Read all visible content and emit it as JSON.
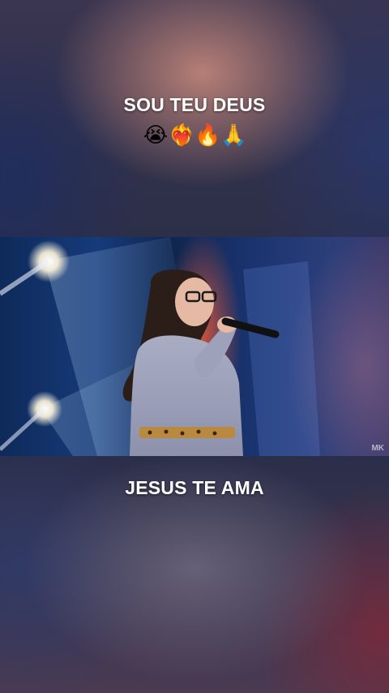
{
  "captions": {
    "top_text": "SOU TEU DEUS",
    "bottom_text": "JESUS TE AMA"
  },
  "emojis": [
    {
      "name": "crying-face-icon",
      "glyph": "😭"
    },
    {
      "name": "heart-on-fire-icon",
      "glyph": "❤️‍🔥"
    },
    {
      "name": "fire-icon",
      "glyph": "🔥"
    },
    {
      "name": "folded-hands-icon",
      "glyph": "🙏"
    }
  ],
  "video": {
    "watermark": "MK"
  }
}
